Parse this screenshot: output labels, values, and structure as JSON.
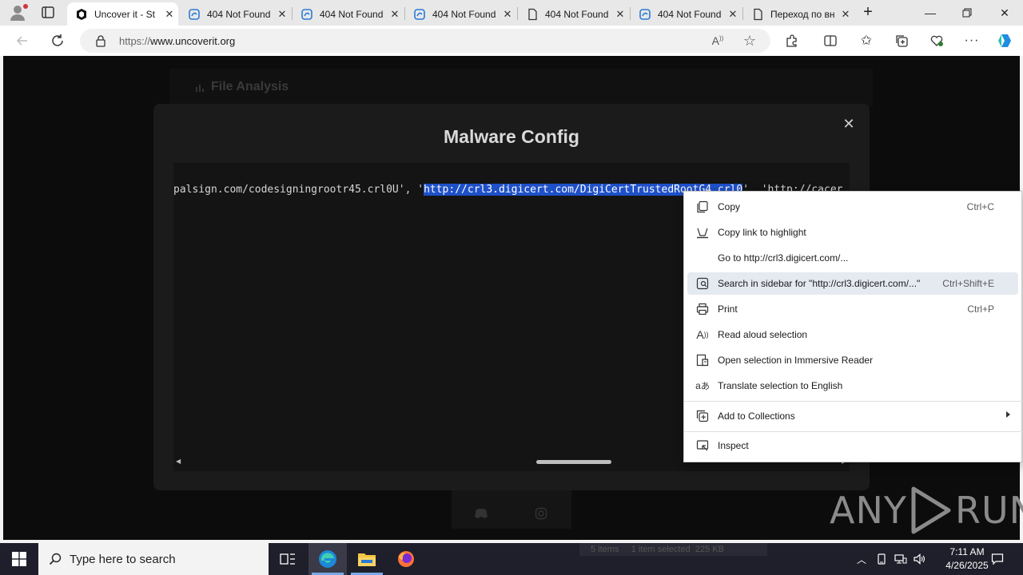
{
  "browser": {
    "tabs": [
      {
        "title": "Uncover it - St",
        "favicon": "uncoverit-logo-icon",
        "active": true
      },
      {
        "title": "404 Not Found",
        "favicon": "edge-page-icon"
      },
      {
        "title": "404 Not Found",
        "favicon": "edge-page-icon"
      },
      {
        "title": "404 Not Found",
        "favicon": "edge-page-icon"
      },
      {
        "title": "404 Not Found",
        "favicon": "document-icon"
      },
      {
        "title": "404 Not Found",
        "favicon": "edge-page-icon"
      },
      {
        "title": "Переход по вн",
        "favicon": "document-icon"
      }
    ],
    "address": {
      "scheme": "https://",
      "host": "www.uncoverit.org"
    }
  },
  "page": {
    "background_header": "File Analysis",
    "modal": {
      "title": "Malware Config",
      "close_glyph": "✕",
      "code_before": "palsign.com/codesigningrootr45.crl0U', '",
      "code_selected": "http://crl3.digicert.com/DigiCertTrustedRootG4.crl0",
      "code_after": "', 'http://cacer"
    },
    "watermark_left": "ANY",
    "watermark_right": "RUN"
  },
  "context_menu": {
    "items": [
      {
        "label": "Copy",
        "shortcut": "Ctrl+C",
        "icon": "copy-icon"
      },
      {
        "label": "Copy link to highlight",
        "shortcut": "",
        "icon": "link-highlight-icon"
      },
      {
        "label": "Go to http://crl3.digicert.com/...",
        "shortcut": "",
        "icon": ""
      },
      {
        "label": "Search in sidebar for \"http://crl3.digicert.com/...\"",
        "shortcut": "Ctrl+Shift+E",
        "icon": "sidebar-search-icon"
      },
      {
        "label": "Print",
        "shortcut": "Ctrl+P",
        "icon": "print-icon"
      },
      {
        "label": "Read aloud selection",
        "shortcut": "",
        "icon": "read-aloud-icon"
      },
      {
        "label": "Open selection in Immersive Reader",
        "shortcut": "",
        "icon": "immersive-reader-icon"
      },
      {
        "label": "Translate selection to English",
        "shortcut": "",
        "icon": "translate-icon"
      },
      {
        "label": "Add to Collections",
        "shortcut": "",
        "icon": "collections-icon"
      },
      {
        "label": "Inspect",
        "shortcut": "",
        "icon": "inspect-icon"
      }
    ]
  },
  "taskbar": {
    "search_placeholder": "Type here to search",
    "explorer_status": "5 items     1 item selected  225 KB",
    "time": "7:11 AM",
    "date": "4/26/2025"
  },
  "colors": {
    "selection": "#1e50c8",
    "taskbar": "#1f1f2b",
    "page_bg": "#0c0c0c"
  }
}
